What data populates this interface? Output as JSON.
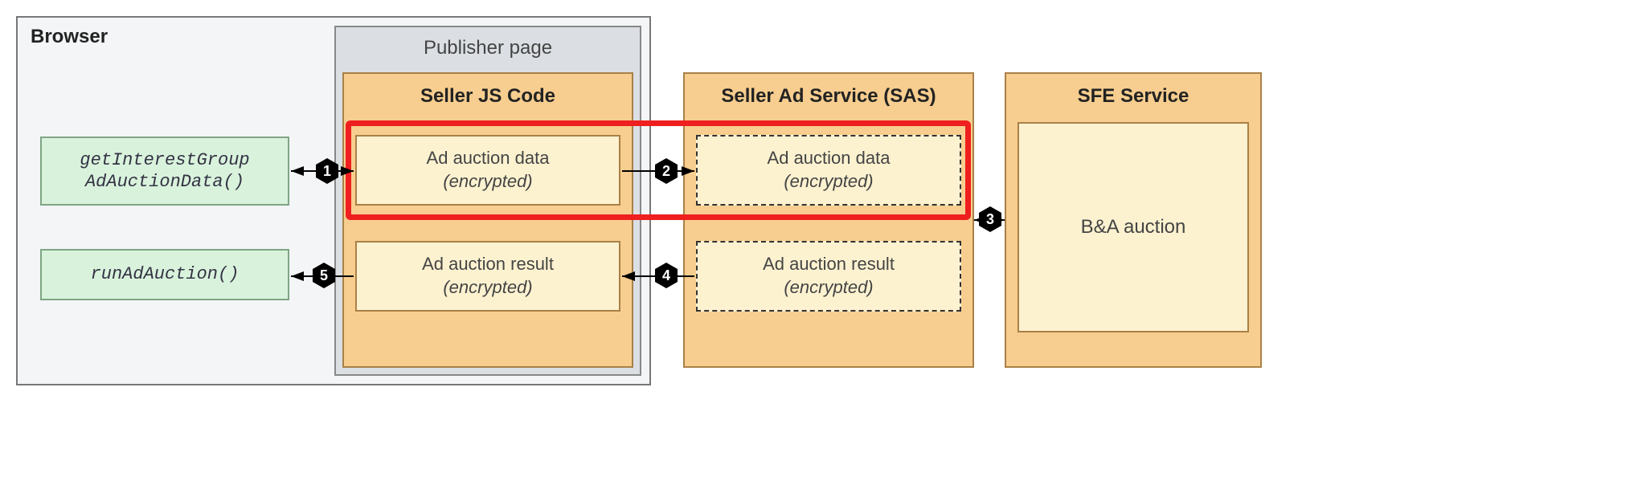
{
  "browser": {
    "label": "Browser"
  },
  "publisher": {
    "label": "Publisher page"
  },
  "seller_js": {
    "title": "Seller JS Code"
  },
  "sas": {
    "title": "Seller Ad Service (SAS)"
  },
  "sfe": {
    "title": "SFE Service"
  },
  "api": {
    "get_ig": "getInterestGroup\nAdAuctionData()",
    "run": "runAdAuction()"
  },
  "boxes": {
    "ad_data": {
      "line1": "Ad auction data",
      "line2": "(encrypted)"
    },
    "ad_result": {
      "line1": "Ad auction result",
      "line2": "(encrypted)"
    },
    "ba": "B&A auction"
  },
  "steps": {
    "s1": "1",
    "s2": "2",
    "s3": "3",
    "s4": "4",
    "s5": "5"
  },
  "colors": {
    "highlight": "#ef1f1f",
    "orange_fill": "#f7ce8f",
    "orange_border": "#a98047",
    "green_fill": "#d9f2dc",
    "green_border": "#7fa584",
    "cream_fill": "#fdf2d0"
  }
}
